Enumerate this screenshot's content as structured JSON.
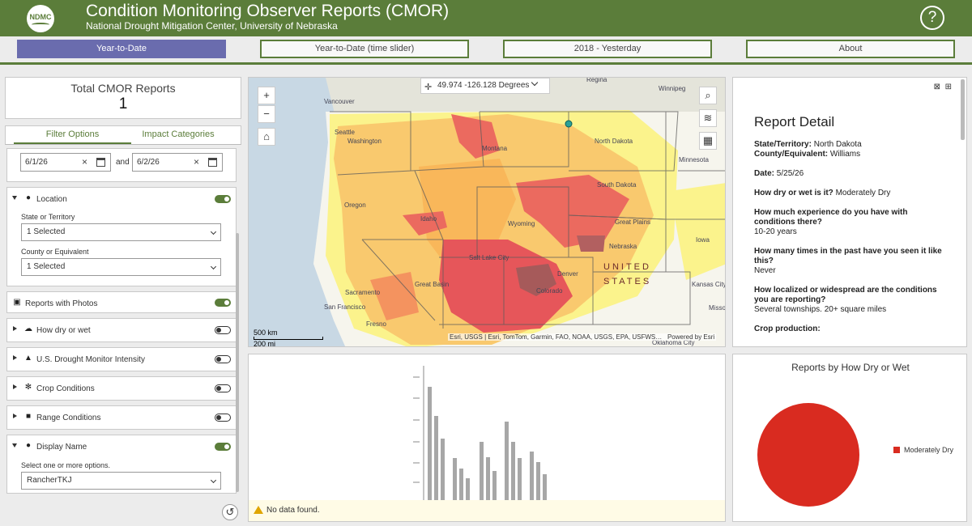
{
  "header": {
    "logo_text": "NDMC",
    "title": "Condition Monitoring Observer Reports (CMOR)",
    "subtitle": "National Drought Mitigation Center, University of Nebraska",
    "help_icon": "?"
  },
  "nav": {
    "tabs": [
      {
        "label": "Year-to-Date",
        "active": true
      },
      {
        "label": "Year-to-Date (time slider)",
        "active": false
      },
      {
        "label": "2018 - Yesterday",
        "active": false
      },
      {
        "label": "About",
        "active": false
      }
    ]
  },
  "summary": {
    "label": "Total CMOR Reports",
    "value": "1"
  },
  "filter_tabs": [
    "Filter Options",
    "Impact Categories"
  ],
  "filters": {
    "date_from": "6/1/26",
    "date_to": "6/2/26",
    "date_joiner": "and",
    "location": {
      "title": "Location",
      "state_label": "State or Territory",
      "state_value": "1 Selected",
      "county_label": "County or Equivalent",
      "county_value": "1 Selected"
    },
    "photos_title": "Reports with Photos",
    "how_dry_title": "How dry or wet",
    "usdm_title": "U.S. Drought Monitor Intensity",
    "crop_title": "Crop Conditions",
    "range_title": "Range Conditions",
    "display_name": {
      "title": "Display Name",
      "hint": "Select one or more options.",
      "value": "RancherTKJ"
    }
  },
  "map": {
    "coordinates": "49.974 -126.128 Degrees",
    "zoom_in": "+",
    "zoom_out": "−",
    "scale_km": "500 km",
    "scale_mi": "200 mi",
    "attribution": "Esri, USGS | Esri, TomTom, Garmin, FAO, NOAA, USGS, EPA, USFWS…",
    "powered_by": "Powered by Esri",
    "places": [
      "Regina",
      "Winnipeg",
      "Vancouver",
      "Seattle",
      "Washington",
      "Montana",
      "North Dakota",
      "Minnesota",
      "Oregon",
      "Idaho",
      "Wyoming",
      "South Dakota",
      "Great Plains",
      "Nebraska",
      "Iowa",
      "Salt Lake City",
      "UNITED",
      "STATES",
      "Great Basin",
      "Denver",
      "Colorado",
      "Kansas City",
      "Sacramento",
      "San Francisco",
      "Fresno",
      "Oklahoma City",
      "Missouri"
    ]
  },
  "detail": {
    "title": "Report Detail",
    "state_label": "State/Territory:",
    "state_value": "North Dakota",
    "county_label": "County/Equivalent:",
    "county_value": "Williams",
    "date_label": "Date:",
    "date_value": "5/25/26",
    "q1": "How dry or wet is it?",
    "a1": "Moderately Dry",
    "q2": "How much experience do you have with conditions there?",
    "a2": "10-20 years",
    "q3": "How many times in the past have you seen it like this?",
    "a3": "Never",
    "q4": "How localized or widespread are the conditions you are reporting?",
    "a4": "Several townships. 20+ square miles",
    "q5": "Crop production:"
  },
  "bar_panel": {
    "message": "No data found."
  },
  "pie": {
    "title": "Reports by How Dry or Wet",
    "color": "#d92b20",
    "legend": "Moderately Dry"
  },
  "colors": {
    "brand": "#5b7d3a",
    "active_tab": "#6a6cae",
    "pie": "#d92b20"
  }
}
